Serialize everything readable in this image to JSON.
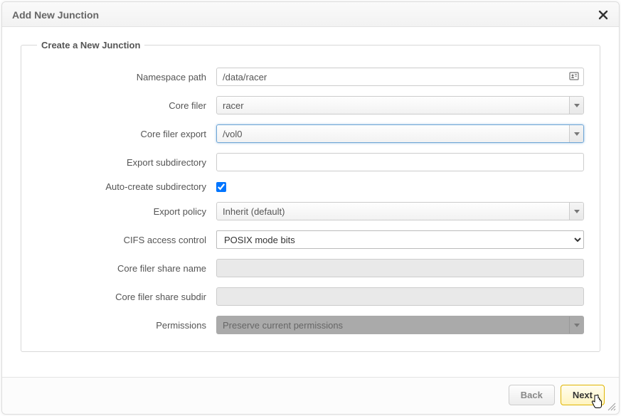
{
  "dialog": {
    "title": "Add New Junction"
  },
  "fieldset": {
    "legend": "Create a New Junction"
  },
  "form": {
    "namespace_path": {
      "label": "Namespace path",
      "value": "/data/racer"
    },
    "core_filer": {
      "label": "Core filer",
      "selected": "racer"
    },
    "core_filer_export": {
      "label": "Core filer export",
      "selected": "/vol0"
    },
    "export_subdir": {
      "label": "Export subdirectory",
      "value": ""
    },
    "auto_create_subdir": {
      "label": "Auto-create subdirectory",
      "checked": true
    },
    "export_policy": {
      "label": "Export policy",
      "selected": "Inherit (default)"
    },
    "cifs_access": {
      "label": "CIFS access control",
      "selected": "POSIX mode bits"
    },
    "share_name": {
      "label": "Core filer share name",
      "value": ""
    },
    "share_subdir": {
      "label": "Core filer share subdir",
      "value": ""
    },
    "permissions": {
      "label": "Permissions",
      "selected": "Preserve current permissions"
    }
  },
  "buttons": {
    "back": "Back",
    "next": "Next"
  }
}
